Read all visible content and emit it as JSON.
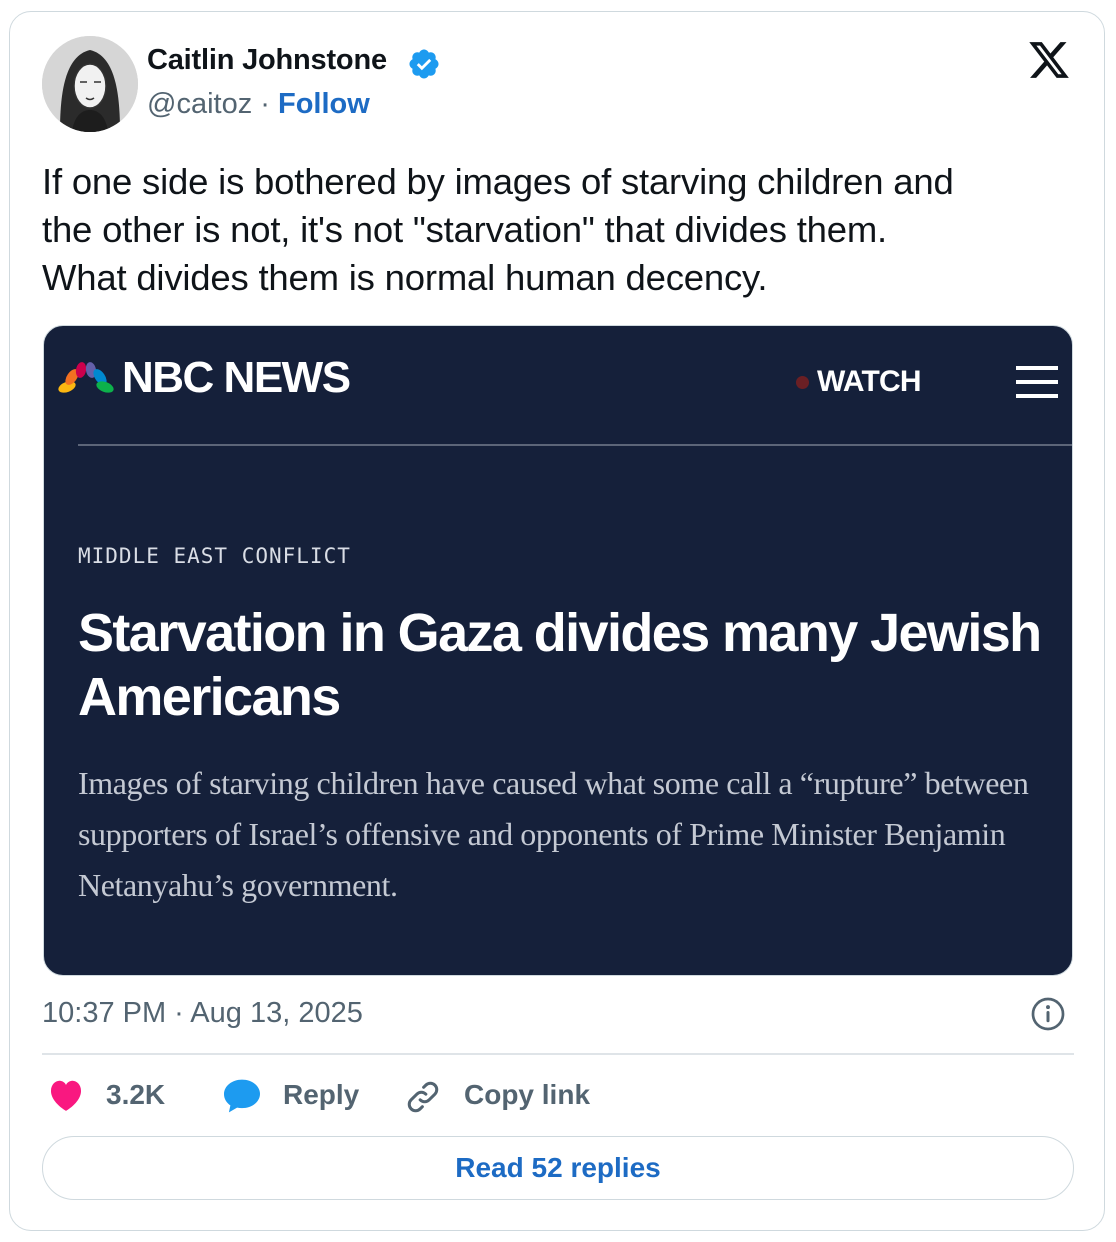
{
  "author": {
    "name": "Caitlin Johnstone",
    "handle": "@caitoz",
    "separator": "·",
    "follow_label": "Follow",
    "verified_color": "#1d9bf0"
  },
  "tweet": {
    "text": "If one side is bothered by images of starving children and\nthe other is not, it's not \"starvation\" that divides them.\nWhat divides them is normal human decency."
  },
  "embed": {
    "logo_text": "NBC NEWS",
    "watch_label": "WATCH",
    "kicker": "MIDDLE EAST CONFLICT",
    "headline": "Starvation in Gaza divides many Jewish Americans",
    "dek": "Images of starving children have caused what some call a “rupture” between supporters of Israel’s offensive and opponents of Prime Minister Benjamin Netanyahu’s government.",
    "background_color": "#15203a"
  },
  "meta": {
    "timestamp": "10:37 PM · Aug 13, 2025"
  },
  "actions": {
    "likes_count": "3.2K",
    "reply_label": "Reply",
    "copy_link_label": "Copy link",
    "like_color": "#f91880",
    "reply_color": "#1d9bf0"
  },
  "footer": {
    "read_replies_label": "Read 52 replies"
  },
  "icons": [
    "x-logo-icon",
    "verified-badge-icon",
    "nbc-peacock-icon",
    "menu-icon",
    "info-icon",
    "heart-icon",
    "speech-bubble-icon",
    "link-icon"
  ]
}
